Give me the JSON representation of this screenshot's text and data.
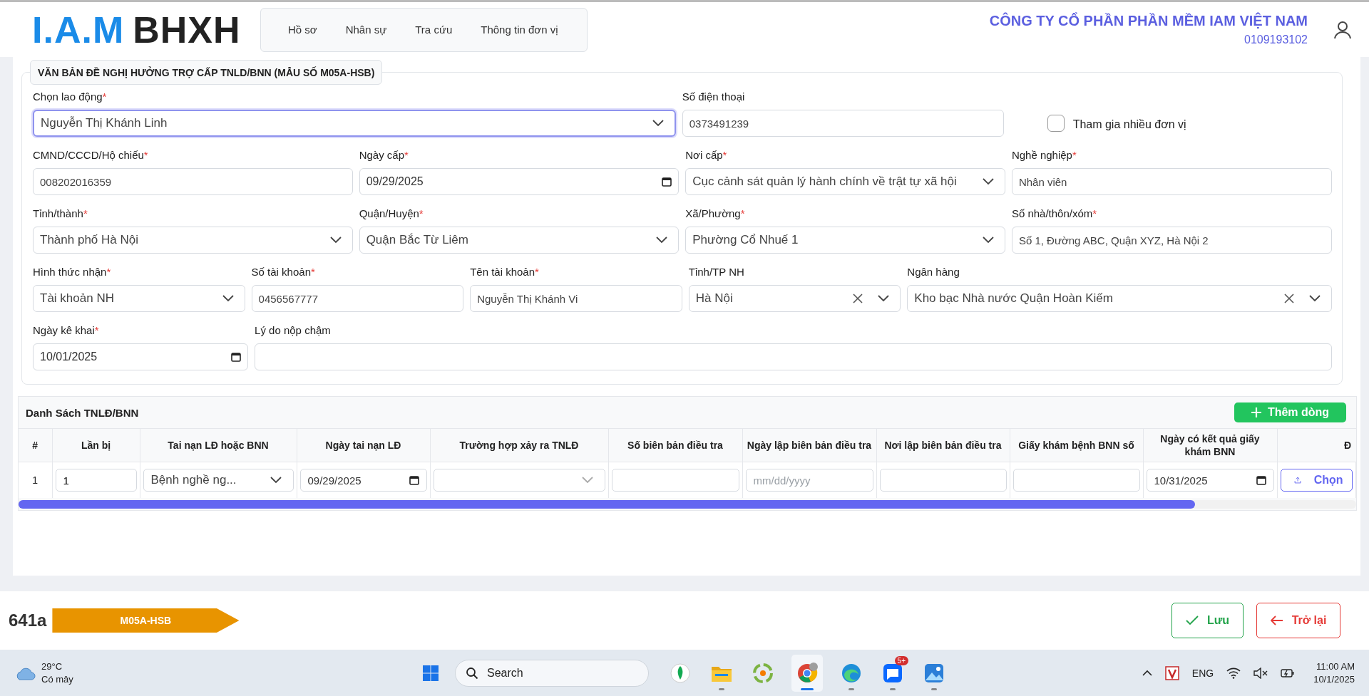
{
  "header": {
    "logo": {
      "initials": "I.A.M",
      "name": "BHXH"
    },
    "nav": [
      {
        "label": "Hồ sơ"
      },
      {
        "label": "Nhân sự"
      },
      {
        "label": "Tra cứu"
      },
      {
        "label": "Thông tin đơn vị"
      }
    ],
    "company": {
      "name": "CÔNG TY CỔ PHẦN PHẦN MỀM IAM VIỆT NAM",
      "tax_code": "0109193102"
    }
  },
  "form": {
    "title": "VĂN BẢN ĐỀ NGHỊ HƯỞNG TRỢ CẤP TNLD/BNN (MẪU SỐ M05A-HSB)",
    "required_mark": "*",
    "lines": [
      {
        "fields": [
          {
            "kind": "select",
            "label": "Chọn lao động",
            "required": true,
            "value": "Nguyễn Thị Khánh Linh",
            "focused": true,
            "clearable": false
          },
          {
            "kind": "text",
            "label": "Số điện thoại",
            "required": false,
            "value": "0373491239",
            "focused": false
          },
          {
            "kind": "checkbox",
            "label": "Tham gia nhiều đơn vị",
            "checked": false
          }
        ]
      },
      {
        "fields": [
          {
            "kind": "text",
            "label": "CMND/CCCD/Hộ chiếu",
            "required": true,
            "value": "008202016359",
            "focused": false
          },
          {
            "kind": "date",
            "label": "Ngày cấp",
            "required": true,
            "value": "09/29/2025",
            "focused": false
          },
          {
            "kind": "select",
            "label": "Nơi cấp",
            "required": true,
            "value": "Cục cảnh sát quản lý hành chính về trật tự xã hội",
            "focused": false,
            "clearable": false
          },
          {
            "kind": "text",
            "label": "Nghề nghiệp",
            "required": true,
            "value": "Nhân viên",
            "focused": false
          }
        ]
      },
      {
        "fields": [
          {
            "kind": "select",
            "label": "Tỉnh/thành",
            "required": true,
            "value": "Thành phố Hà Nội",
            "focused": false,
            "clearable": false
          },
          {
            "kind": "select",
            "label": "Quận/Huyện",
            "required": true,
            "value": "Quận Bắc Từ Liêm",
            "focused": false,
            "clearable": false
          },
          {
            "kind": "select",
            "label": "Xã/Phường",
            "required": true,
            "value": "Phường Cổ Nhuế 1",
            "focused": false,
            "clearable": false
          },
          {
            "kind": "text",
            "label": "Số nhà/thôn/xóm",
            "required": true,
            "value": "Số 1, Đường ABC, Quận XYZ, Hà Nội 2",
            "focused": false
          }
        ]
      },
      {
        "fields": [
          {
            "kind": "select",
            "label": "Hình thức nhận",
            "required": true,
            "value": "Tài khoản NH",
            "focused": false,
            "clearable": false
          },
          {
            "kind": "text",
            "label": "Số tài khoản",
            "required": true,
            "value": "0456567777",
            "focused": false
          },
          {
            "kind": "text",
            "label": "Tên tài khoản",
            "required": true,
            "value": "Nguyễn Thị Khánh Vi",
            "focused": false
          },
          {
            "kind": "select",
            "label": "Tỉnh/TP NH",
            "required": false,
            "value": "Hà Nội",
            "focused": false,
            "clearable": true
          },
          {
            "kind": "select",
            "label": "Ngân hàng",
            "required": false,
            "value": "Kho bạc Nhà nước Quận Hoàn Kiếm",
            "focused": false,
            "clearable": true
          }
        ]
      },
      {
        "fields": [
          {
            "kind": "date",
            "label": "Ngày kê khai",
            "required": true,
            "value": "10/01/2025",
            "focused": false
          },
          {
            "kind": "text",
            "label": "Lý do nộp chậm",
            "required": false,
            "focused": false
          }
        ]
      }
    ]
  },
  "table": {
    "title": "Danh Sách TNLĐ/BNN",
    "add_button": "Thêm dòng",
    "columns": [
      "#",
      "Lần bị",
      "Tai nạn LĐ hoặc BNN",
      "Ngày tai nạn LĐ",
      "Trường hợp xảy ra TNLĐ",
      "Số biên bản điều tra",
      "Ngày lập biên bản điều tra",
      "Nơi lập biên bản điều tra",
      "Giấy khám bệnh BNN số",
      "Ngày có kết quả giấy khám BNN",
      "Đ"
    ],
    "rows": [
      {
        "cells": [
          {
            "kind": "number",
            "value": "1"
          },
          {
            "kind": "input",
            "value": "1"
          },
          {
            "kind": "select",
            "value": "Bệnh nghề ng..."
          },
          {
            "kind": "date",
            "value": "09/29/2025"
          },
          {
            "kind": "select"
          },
          {
            "kind": "input"
          },
          {
            "kind": "date",
            "placeholder": "mm/dd/yyyy"
          },
          {
            "kind": "input"
          },
          {
            "kind": "input"
          },
          {
            "kind": "date",
            "value": "10/31/2025"
          },
          {
            "kind": "upload",
            "label": "Chọn"
          }
        ]
      }
    ]
  },
  "footer": {
    "code": "641a",
    "badge": "M05A-HSB",
    "buttons": [
      {
        "kind": "save",
        "label": "Lưu"
      },
      {
        "kind": "back",
        "label": "Trở lại"
      }
    ]
  },
  "taskbar": {
    "weather": {
      "temperature": "29°C",
      "condition": "Có mây"
    },
    "search_placeholder": "Search",
    "apps": [
      {
        "kind": "leaf",
        "running": false,
        "active": false
      },
      {
        "kind": "folder",
        "running": true,
        "active": false
      },
      {
        "kind": "clover",
        "running": false,
        "active": false
      },
      {
        "kind": "browser",
        "running": true,
        "active": true
      },
      {
        "kind": "wave",
        "running": true,
        "active": false
      },
      {
        "kind": "chat",
        "running": true,
        "active": false,
        "badge": "5+"
      },
      {
        "kind": "photos",
        "running": true,
        "active": false
      }
    ],
    "language": "ENG",
    "time": "11:00 AM",
    "date": "10/1/2025"
  }
}
